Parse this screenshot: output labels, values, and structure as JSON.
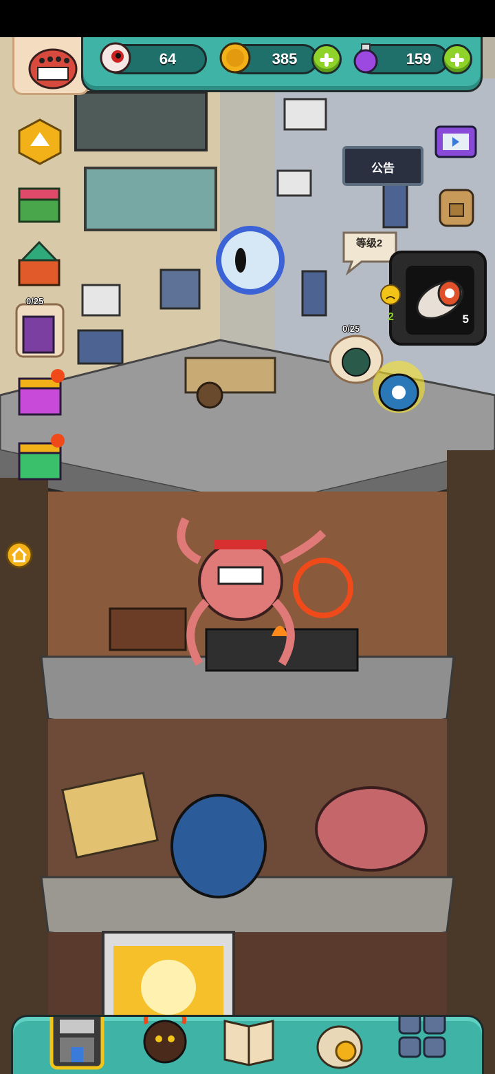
{
  "resources": {
    "eye": {
      "icon": "eyeball-icon",
      "value": "64"
    },
    "coin": {
      "icon": "coin-icon",
      "value": "385"
    },
    "potion": {
      "icon": "potion-icon",
      "value": "159"
    }
  },
  "side_buttons": {
    "card_event_hearts": "0/25"
  },
  "notice_board": {
    "label": "公告"
  },
  "level_bubble": {
    "label": "等级2"
  },
  "npc_bubble": {
    "hearts": "0/25"
  },
  "item_popup": {
    "left_count": "2",
    "count": "5"
  },
  "bottom_nav": [
    {
      "name": "building",
      "icon": "building-icon"
    },
    {
      "name": "monster",
      "icon": "monster-icon"
    },
    {
      "name": "book",
      "icon": "book-icon"
    },
    {
      "name": "bag",
      "icon": "money-bag-icon"
    },
    {
      "name": "more",
      "icon": "grid-icon"
    }
  ],
  "colors": {
    "panel_teal": "#3fb3a6",
    "plus_green": "#8fd22a",
    "sky": "#c9cfd4"
  }
}
